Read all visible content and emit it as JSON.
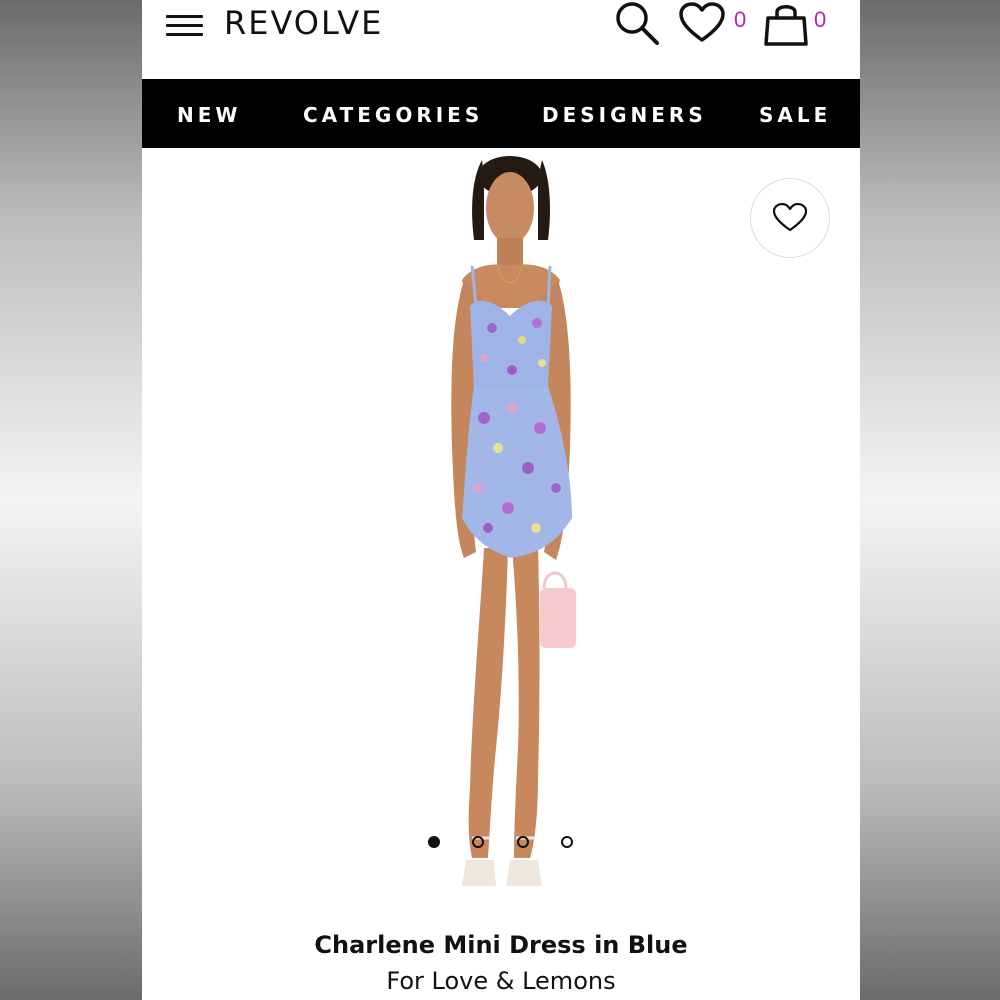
{
  "header": {
    "logo": "REVOLVE",
    "menu_icon": "hamburger-menu-icon",
    "search_icon": "search-icon",
    "wishlist_icon": "heart-icon",
    "wishlist_count": "0",
    "bag_icon": "shopping-bag-icon",
    "bag_count": "0",
    "count_color": "#b026a8"
  },
  "nav": {
    "items": [
      {
        "label": "NEW"
      },
      {
        "label": "CATEGORIES"
      },
      {
        "label": "DESIGNERS"
      },
      {
        "label": "SALE"
      }
    ]
  },
  "product": {
    "wishlist_icon": "heart-outline-icon",
    "image": "model-wearing-blue-floral-mini-dress",
    "carousel": {
      "total": 4,
      "active": 1
    },
    "name": "Charlene Mini Dress in Blue",
    "brand": "For Love & Lemons"
  }
}
